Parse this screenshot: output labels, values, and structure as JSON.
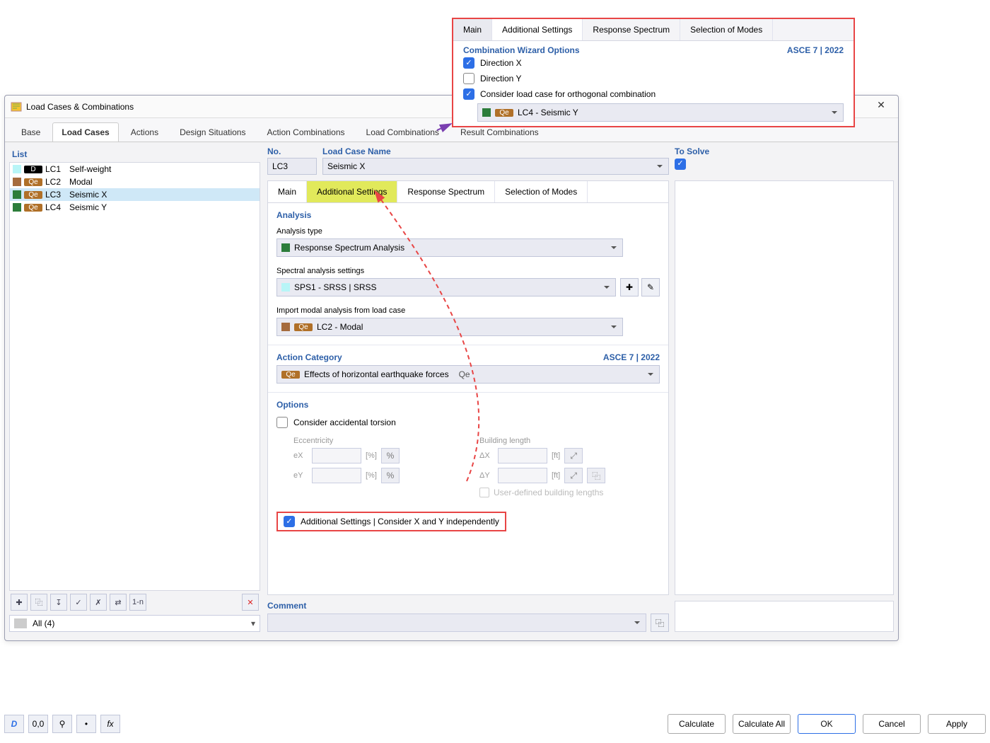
{
  "window": {
    "title": "Load Cases & Combinations"
  },
  "tabs": {
    "base": "Base",
    "load_cases": "Load Cases",
    "actions": "Actions",
    "design": "Design Situations",
    "action_comb": "Action Combinations",
    "load_comb": "Load Combinations",
    "result_comb": "Result Combinations"
  },
  "list": {
    "header": "List",
    "items": [
      {
        "swatch": "#b8f5f7",
        "badge": "D",
        "badgeCls": "D",
        "code": "LC1",
        "name": "Self-weight"
      },
      {
        "swatch": "#a56b3e",
        "badge": "Qe",
        "badgeCls": "Qe",
        "code": "LC2",
        "name": "Modal"
      },
      {
        "swatch": "#2c7d3b",
        "badge": "Qe",
        "badgeCls": "Qe",
        "code": "LC3",
        "name": "Seismic X",
        "selected": true
      },
      {
        "swatch": "#2c7d3b",
        "badge": "Qe",
        "badgeCls": "Qe",
        "code": "LC4",
        "name": "Seismic Y"
      }
    ],
    "filter": "All (4)"
  },
  "form": {
    "no_label": "No.",
    "no_value": "LC3",
    "name_label": "Load Case Name",
    "name_value": "Seismic X",
    "solve_label": "To Solve",
    "inner_tabs": {
      "main": "Main",
      "addl": "Additional Settings",
      "resp": "Response Spectrum",
      "modes": "Selection of Modes"
    },
    "analysis_hdr": "Analysis",
    "analysis_type_lbl": "Analysis type",
    "analysis_type_val": "Response Spectrum Analysis",
    "spectral_lbl": "Spectral analysis settings",
    "spectral_val": "SPS1 - SRSS | SRSS",
    "import_lbl": "Import modal analysis from load case",
    "import_val": "LC2 - Modal",
    "action_hdr": "Action Category",
    "action_std": "ASCE 7 | 2022",
    "action_val": "Effects of horizontal earthquake forces",
    "action_sfx": "Qe",
    "options_hdr": "Options",
    "torsion_label": "Consider accidental torsion",
    "ecc_label": "Eccentricity",
    "bldg_label": "Building length",
    "ex": "eX",
    "ey": "eY",
    "pct": "[%]",
    "dx": "ΔX",
    "dy": "ΔY",
    "ft": "[ft]",
    "udbl": "User-defined building lengths",
    "xy_label": "Additional Settings | Consider X and Y independently",
    "comment_hdr": "Comment"
  },
  "callout": {
    "tabs": {
      "main": "Main",
      "addl": "Additional Settings",
      "resp": "Response Spectrum",
      "modes": "Selection of Modes"
    },
    "hdr": "Combination Wizard Options",
    "std": "ASCE 7 | 2022",
    "dirx": "Direction X",
    "diry": "Direction Y",
    "ortho_label": "Consider load case for orthogonal combination",
    "ortho_val": "LC4 - Seismic Y"
  },
  "buttons": {
    "calc": "Calculate",
    "calc_all": "Calculate All",
    "ok": "OK",
    "cancel": "Cancel",
    "apply": "Apply"
  }
}
